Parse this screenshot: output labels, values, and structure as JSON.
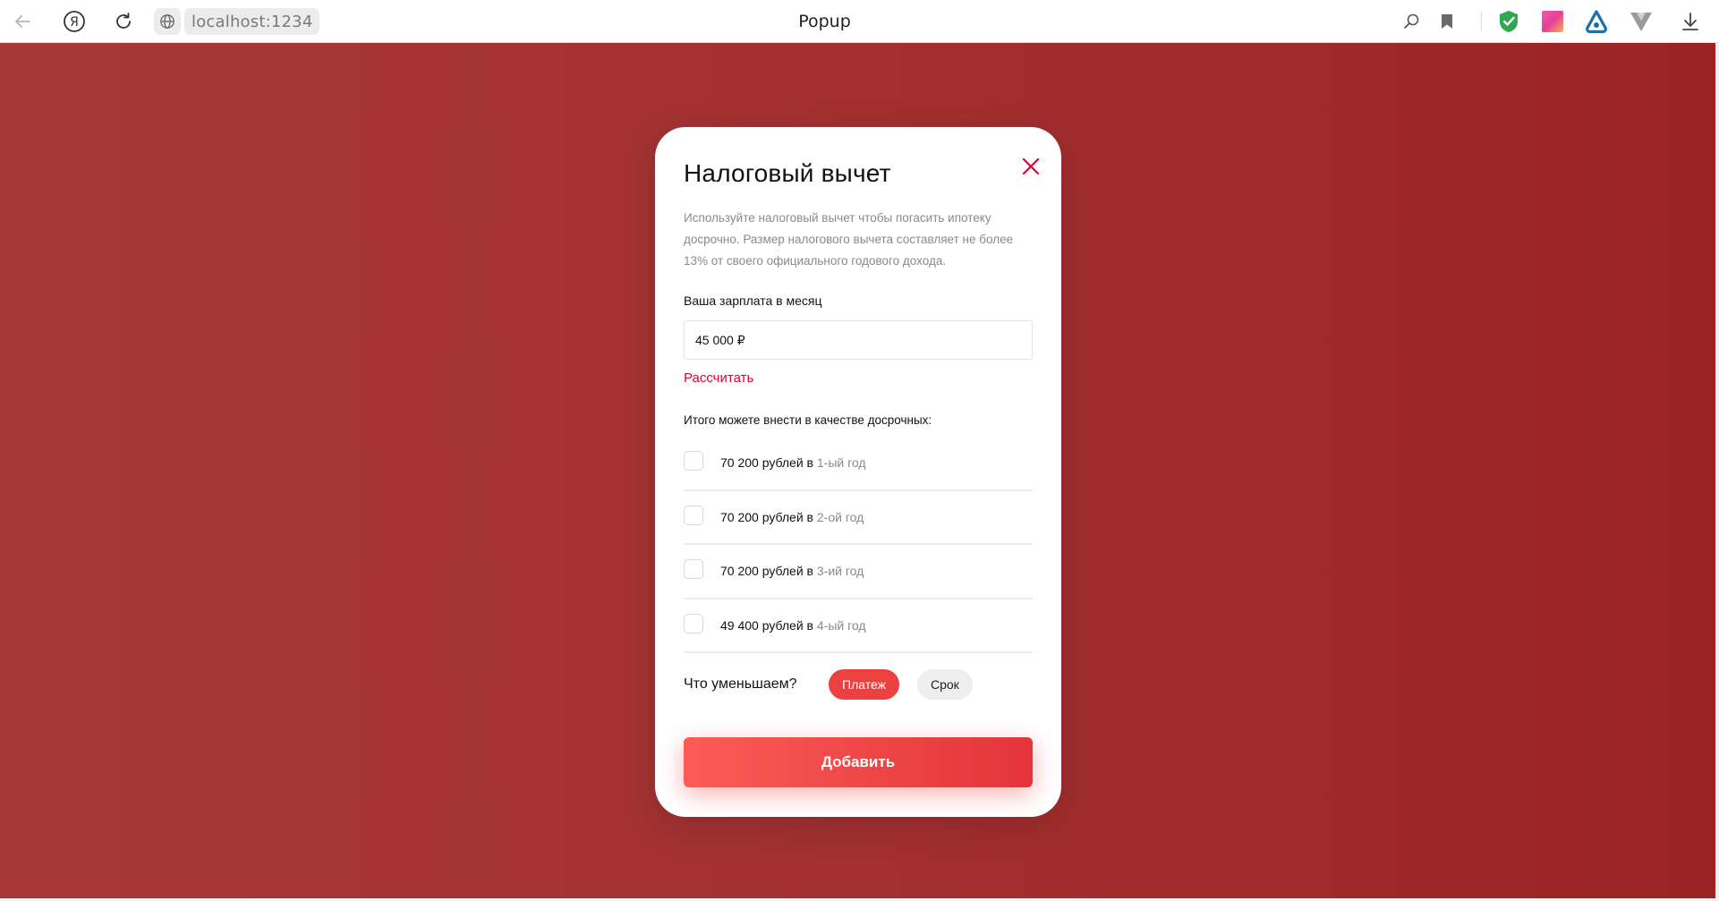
{
  "browser": {
    "url": "localhost:1234",
    "tab_title": "Popup",
    "icons": [
      "back-arrow-icon",
      "yandex-icon",
      "reload-icon",
      "globe-icon",
      "search-zoom-icon",
      "bookmark-icon",
      "shield-extension-icon",
      "gradient-extension-icon",
      "alisa-icon",
      "vue-devtools-icon",
      "download-icon"
    ]
  },
  "colors": {
    "background": "#a33030",
    "accent": "#e4002b",
    "button": "#ec4141"
  },
  "modal": {
    "title": "Налоговый вычет",
    "description_lines": [
      "Используйте налоговый вычет чтобы погасить ипотеку",
      "досрочно. Размер налогового вычета составляет не более",
      "13% от своего официального годового дохода."
    ],
    "salary_label": "Ваша зарплата в месяц",
    "salary_value": "45 000 ₽",
    "calculate_link": "Рассчитать",
    "total_label": "Итого можете внести в качестве досрочных:",
    "options": [
      {
        "amount": "70 200 рублей в",
        "year": "1-ый год",
        "checked": false
      },
      {
        "amount": "70 200 рублей в",
        "year": "2-ой год",
        "checked": false
      },
      {
        "amount": "70 200 рублей в",
        "year": "3-ий год",
        "checked": false
      },
      {
        "amount": "49 400 рублей в",
        "year": "4-ый год",
        "checked": false
      }
    ],
    "reduce_label": "Что уменьшаем?",
    "reduce_options": [
      "Платеж",
      "Срок"
    ],
    "reduce_selected": "Платеж",
    "add_button": "Добавить"
  }
}
